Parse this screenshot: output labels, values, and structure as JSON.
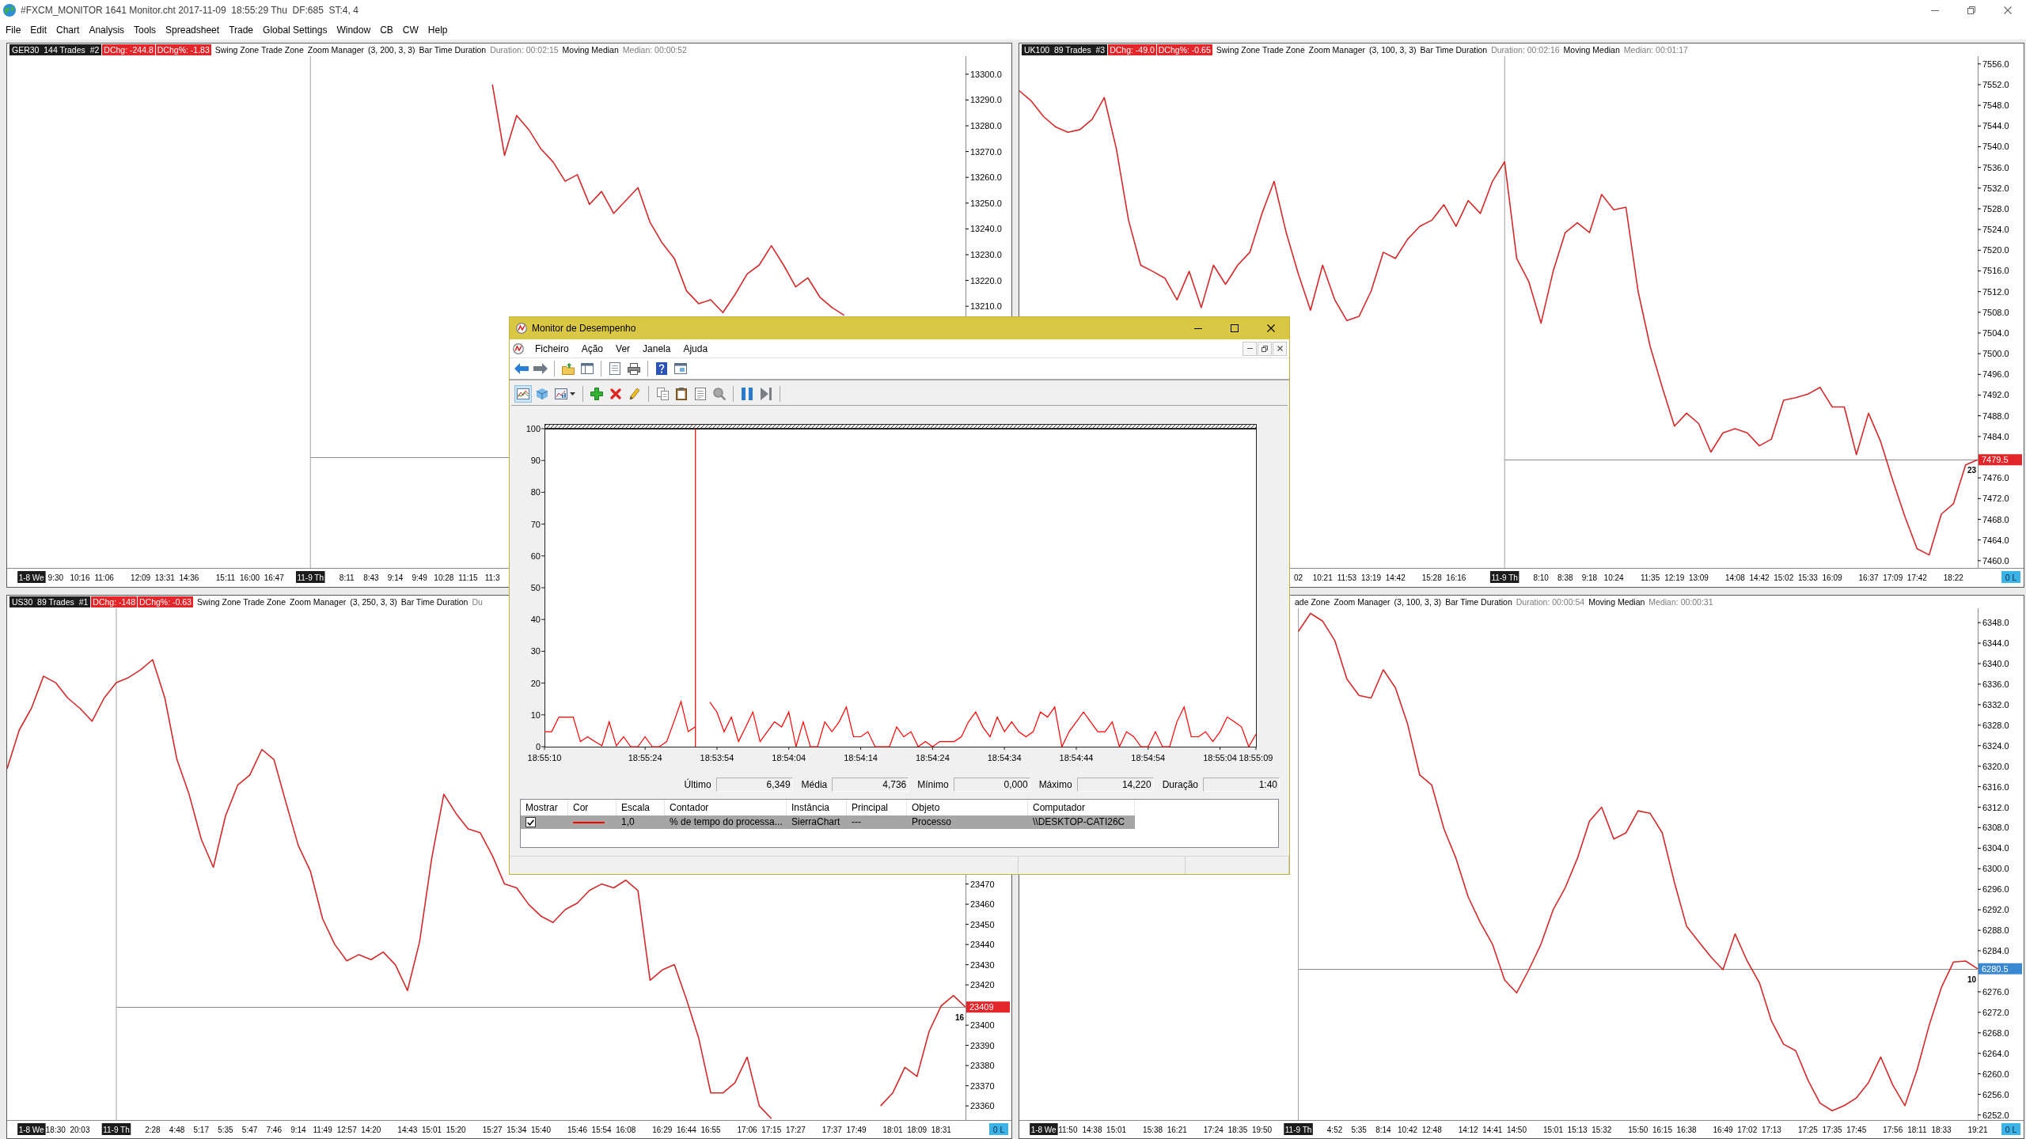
{
  "window": {
    "title": "#FXCM_MONITOR 1641 Monitor.cht 2017-11-09  18:55:29 Thu  DF:685  ST:4, 4",
    "menu": [
      "File",
      "Edit",
      "Chart",
      "Analysis",
      "Tools",
      "Spreadsheet",
      "Trade",
      "Global Settings",
      "Window",
      "CB",
      "CW",
      "Help"
    ]
  },
  "charts": [
    {
      "header": [
        {
          "kind": "symbol",
          "text": "GER30  144 Trades  #2"
        },
        {
          "kind": "change",
          "text": "DChg: -244.8"
        },
        {
          "kind": "change",
          "text": "DChg%: -1.83"
        },
        {
          "kind": "study",
          "text": "Swing Zone Trade Zone"
        },
        {
          "kind": "study",
          "text": "Zoom Manager"
        },
        {
          "kind": "study",
          "text": "(3, 200, 3, 3)"
        },
        {
          "kind": "study",
          "text": "Bar Time Duration"
        },
        {
          "kind": "value",
          "text": "Duration: 00:02:15"
        },
        {
          "kind": "study",
          "text": "Moving Median"
        },
        {
          "kind": "value",
          "text": "Median: 00:00:52"
        }
      ],
      "first_label_highlighted": true,
      "chart_data": {
        "type": "line",
        "categories": [
          null,
          null,
          "1-8 We",
          null,
          "9:30",
          null,
          "10:16",
          null,
          "11:06",
          null,
          null,
          "12:09",
          null,
          "13:31",
          null,
          "14:36",
          null,
          null,
          "15:11",
          null,
          "16:00",
          null,
          "16:47",
          null,
          null,
          "11-9 Th",
          null,
          null,
          "8:11",
          null,
          "8:43",
          null,
          "9:14",
          null,
          "9:49",
          null,
          "10:28",
          null,
          "11:15",
          null,
          "11:3",
          null,
          null,
          null,
          null,
          null,
          null,
          null,
          null,
          null,
          null,
          null,
          null,
          null,
          null,
          null,
          null,
          null,
          null,
          null,
          null,
          null,
          null,
          null,
          null,
          null,
          null,
          null,
          null,
          null,
          null,
          null,
          null,
          null,
          null,
          null,
          null,
          null,
          null,
          null
        ],
        "ylim": [
          13108.5,
          13307
        ],
        "yticks": [
          {
            "value": 13300,
            "label": "13300.0"
          },
          {
            "value": 13290,
            "label": "13290.0"
          },
          {
            "value": 13280,
            "label": "13280.0"
          },
          {
            "value": 13270,
            "label": "13270.0"
          },
          {
            "value": 13260,
            "label": "13260.0"
          },
          {
            "value": 13250,
            "label": "13250.0"
          },
          {
            "value": 13240,
            "label": "13240.0"
          },
          {
            "value": 13230,
            "label": "13230.0"
          },
          {
            "value": 13220,
            "label": "13220.0"
          },
          {
            "value": 13210,
            "label": "13210.0"
          }
        ],
        "series": [
          {
            "color": "#d42a2a",
            "values": [
              null,
              null,
              null,
              null,
              null,
              null,
              null,
              null,
              null,
              null,
              null,
              null,
              null,
              null,
              null,
              null,
              null,
              null,
              null,
              null,
              null,
              null,
              null,
              null,
              null,
              null,
              null,
              null,
              null,
              null,
              null,
              null,
              null,
              null,
              null,
              null,
              null,
              null,
              null,
              null,
              13296,
              13268.5,
              13284,
              13278.5,
              13271,
              13266,
              13258.5,
              13261,
              13249.5,
              13254.5,
              13246,
              13251,
              13256,
              13242.5,
              13234.5,
              13228.5,
              13216,
              13211,
              13212.5,
              13207.5,
              13214.5,
              13222.5,
              13226,
              13233.5,
              13226,
              13217.5,
              13221,
              13213.5,
              13209.5,
              13206.5,
              null,
              null,
              null,
              null,
              null,
              null,
              null,
              null,
              null,
              null
            ]
          }
        ],
        "ref_lines": [
          {
            "axis": "x",
            "value": "11-9 Th"
          },
          {
            "axis": "y",
            "value": 13151.5
          }
        ]
      }
    },
    {
      "header": [
        {
          "kind": "symbol",
          "text": "UK100  89 Trades  #3"
        },
        {
          "kind": "change",
          "text": "DChg: -49.0"
        },
        {
          "kind": "change",
          "text": "DChg%: -0.65"
        },
        {
          "kind": "study",
          "text": "Swing Zone Trade Zone"
        },
        {
          "kind": "study",
          "text": "Zoom Manager"
        },
        {
          "kind": "study",
          "text": "(3, 100, 3, 3)"
        },
        {
          "kind": "study",
          "text": "Bar Time Duration"
        },
        {
          "kind": "value",
          "text": "Duration: 00:02:16"
        },
        {
          "kind": "study",
          "text": "Moving Median"
        },
        {
          "kind": "value",
          "text": "Median: 00:01:17"
        }
      ],
      "chart_data": {
        "type": "line",
        "categories": [
          null,
          null,
          null,
          null,
          null,
          null,
          null,
          null,
          null,
          null,
          null,
          null,
          null,
          null,
          null,
          null,
          null,
          null,
          null,
          null,
          null,
          null,
          null,
          "02",
          null,
          "10:21",
          null,
          "11:53",
          null,
          "13:19",
          null,
          "14:42",
          null,
          null,
          "15:28",
          null,
          "16:16",
          null,
          null,
          null,
          "11-9 Th",
          null,
          null,
          "8:10",
          null,
          "8:38",
          null,
          "9:18",
          null,
          "10:24",
          null,
          null,
          "11:35",
          null,
          "12:19",
          null,
          "13:09",
          null,
          null,
          "14:08",
          null,
          "14:42",
          null,
          "15:02",
          null,
          "15:33",
          null,
          "16:09",
          null,
          null,
          "16:37",
          null,
          "17:09",
          null,
          "17:42",
          null,
          null,
          "18:22",
          null,
          null
        ],
        "ylim": [
          7458.6,
          7557.5
        ],
        "yticks": [
          {
            "value": 7556,
            "label": "7556.0"
          },
          {
            "value": 7552,
            "label": "7552.0"
          },
          {
            "value": 7548,
            "label": "7548.0"
          },
          {
            "value": 7544,
            "label": "7544.0"
          },
          {
            "value": 7540,
            "label": "7540.0"
          },
          {
            "value": 7536,
            "label": "7536.0"
          },
          {
            "value": 7532,
            "label": "7532.0"
          },
          {
            "value": 7528,
            "label": "7528.0"
          },
          {
            "value": 7524,
            "label": "7524.0"
          },
          {
            "value": 7520,
            "label": "7520.0"
          },
          {
            "value": 7516,
            "label": "7516.0"
          },
          {
            "value": 7512,
            "label": "7512.0"
          },
          {
            "value": 7508,
            "label": "7508.0"
          },
          {
            "value": 7504,
            "label": "7504.0"
          },
          {
            "value": 7500,
            "label": "7500.0"
          },
          {
            "value": 7496,
            "label": "7496.0"
          },
          {
            "value": 7492,
            "label": "7492.0"
          },
          {
            "value": 7488,
            "label": "7488.0"
          },
          {
            "value": 7484,
            "label": "7484.0"
          },
          {
            "value": 7476,
            "label": "7476.0"
          },
          {
            "value": 7472,
            "label": "7472.0"
          },
          {
            "value": 7468,
            "label": "7468.0"
          },
          {
            "value": 7464,
            "label": "7464.0"
          },
          {
            "value": 7460,
            "label": "7460.0"
          }
        ],
        "series": [
          {
            "color": "#d42a2a",
            "values": [
              7550.8,
              7548.8,
              7545.8,
              7543.8,
              7542.8,
              7543.3,
              7545.3,
              7549.5,
              7539.6,
              7525.8,
              7517.1,
              7515.9,
              7514.6,
              7510.4,
              7515.9,
              7508.9,
              7517.1,
              7513.4,
              7517.1,
              7519.6,
              7527.1,
              7533.3,
              7523.4,
              7515.4,
              7508.4,
              7517.1,
              7510.4,
              7506.4,
              7507.2,
              7512.1,
              7519.6,
              7518.4,
              7522.1,
              7524.6,
              7525.8,
              7528.8,
              7524.6,
              7529.6,
              7527.1,
              7533.3,
              7537.1,
              7518.4,
              7513.9,
              7505.9,
              7515.9,
              7523.4,
              7525.3,
              7523.4,
              7530.8,
              7527.8,
              7528.3,
              7512.1,
              7501.4,
              7493.5,
              7486.0,
              7488.5,
              7486.5,
              7481.0,
              7484.7,
              7485.5,
              7484.7,
              7482.2,
              7483.5,
              7491.0,
              7491.5,
              7492.2,
              7493.5,
              7489.7,
              7489.7,
              7480.5,
              7488.5,
              7483.0,
              7475.5,
              7468.5,
              7462.3,
              7461.1,
              7469.0,
              7471.0,
              7478.5,
              7479.5
            ]
          }
        ],
        "ref_lines": [
          {
            "axis": "x",
            "value": "11-9 Th"
          },
          {
            "axis": "y",
            "value": 7479.5,
            "label": "7479.5"
          }
        ]
      },
      "price_tag": {
        "color": "#e4262a"
      },
      "bar_count": "23",
      "corner_label": "0 L"
    },
    {
      "header": [
        {
          "kind": "symbol",
          "text": "US30  89 Trades  #1"
        },
        {
          "kind": "change",
          "text": "DChg: -148"
        },
        {
          "kind": "change",
          "text": "DChg%: -0.63"
        },
        {
          "kind": "study",
          "text": "Swing Zone Trade Zone"
        },
        {
          "kind": "study",
          "text": "Zoom Manager"
        },
        {
          "kind": "study",
          "text": "(3, 250, 3, 3)"
        },
        {
          "kind": "study",
          "text": "Bar Time Duration"
        },
        {
          "kind": "value",
          "text": "Du"
        }
      ],
      "first_label_highlighted": true,
      "chart_data": {
        "type": "line",
        "categories": [
          null,
          null,
          "1-8 We",
          null,
          "18:30",
          null,
          "20:03",
          null,
          null,
          "11-9 Th",
          null,
          null,
          "2:28",
          null,
          "4:48",
          null,
          "5:17",
          null,
          "5:35",
          null,
          "5:47",
          null,
          "7:46",
          null,
          "9:14",
          null,
          "11:49",
          null,
          "12:57",
          null,
          "14:20",
          null,
          null,
          "14:43",
          null,
          "15:01",
          null,
          "15:20",
          null,
          null,
          "15:27",
          null,
          "15:34",
          null,
          "15:40",
          null,
          null,
          "15:46",
          null,
          "15:54",
          null,
          "16:08",
          null,
          null,
          "16:29",
          null,
          "16:44",
          null,
          "16:55",
          null,
          null,
          "17:06",
          null,
          "17:15",
          null,
          "17:27",
          null,
          null,
          "17:37",
          null,
          "17:49",
          null,
          null,
          "18:01",
          null,
          "18:09",
          null,
          "18:31",
          null,
          null
        ],
        "ylim": [
          23353.0,
          23606.7
        ],
        "yticks": [
          {
            "value": 23470,
            "label": "23470"
          },
          {
            "value": 23460,
            "label": "23460"
          },
          {
            "value": 23450,
            "label": "23450"
          },
          {
            "value": 23440,
            "label": "23440"
          },
          {
            "value": 23430,
            "label": "23430"
          },
          {
            "value": 23420,
            "label": "23420"
          },
          {
            "value": 23400,
            "label": "23400"
          },
          {
            "value": 23390,
            "label": "23390"
          },
          {
            "value": 23380,
            "label": "23380"
          },
          {
            "value": 23370,
            "label": "23370"
          },
          {
            "value": 23360,
            "label": "23360"
          }
        ],
        "series": [
          {
            "color": "#d42a2a",
            "values": [
              23527.2,
              23546.3,
              23557.1,
              23573.0,
              23569.8,
              23562.2,
              23557.1,
              23550.7,
              23562.2,
              23569.8,
              23572.3,
              23576.2,
              23581.2,
              23562.2,
              23531.7,
              23514.5,
              23492.2,
              23478.3,
              23503.7,
              23519.0,
              23524.0,
              23536.7,
              23531.7,
              23510.0,
              23489.1,
              23476.4,
              23452.8,
              23440.1,
              23431.9,
              23435.0,
              23432.5,
              23436.3,
              23430.0,
              23417.2,
              23441.4,
              23482.7,
              23514.5,
              23505.0,
              23497.3,
              23495.4,
              23484.0,
              23470.0,
              23468.1,
              23459.8,
              23454.1,
              23450.9,
              23457.3,
              23460.5,
              23466.8,
              23470.0,
              23468.1,
              23471.9,
              23466.8,
              23422.3,
              23427.4,
              23430.0,
              23412.8,
              23393.7,
              23366.4,
              23366.4,
              23371.5,
              23384.2,
              23360.0,
              23353.7,
              null,
              null,
              null,
              null,
              null,
              null,
              null,
              null,
              23360.0,
              23366.4,
              23379.1,
              23374.6,
              23396.9,
              23409.6,
              23414.7,
              23409.0
            ]
          }
        ],
        "ref_lines": [
          {
            "axis": "x",
            "value": "11-9 Th"
          },
          {
            "axis": "y",
            "value": 23409,
            "label": "23409"
          }
        ]
      },
      "price_tag": {
        "color": "#e4262a"
      },
      "bar_count": "16",
      "corner_label": "0 L"
    },
    {
      "header": [
        {
          "kind": "study",
          "text": "ade Zone"
        },
        {
          "kind": "study",
          "text": "Zoom Manager"
        },
        {
          "kind": "study",
          "text": "(3, 100, 3, 3)"
        },
        {
          "kind": "study",
          "text": "Bar Time Duration"
        },
        {
          "kind": "value",
          "text": "Duration: 00:00:54"
        },
        {
          "kind": "study",
          "text": "Moving Median"
        },
        {
          "kind": "value",
          "text": "Median: 00:00:31"
        }
      ],
      "first_label_highlighted": true,
      "chart_data": {
        "type": "line",
        "categories": [
          null,
          null,
          "1-8 We",
          null,
          "11:50",
          null,
          "14:38",
          null,
          "15:01",
          null,
          null,
          "15:38",
          null,
          "16:21",
          null,
          null,
          "17:24",
          null,
          "18:35",
          null,
          "19:50",
          null,
          null,
          "11-9 Th",
          null,
          null,
          "4:52",
          null,
          "5:35",
          null,
          "8:14",
          null,
          "10:42",
          null,
          "12:48",
          null,
          null,
          "14:12",
          null,
          "14:41",
          null,
          "14:50",
          null,
          null,
          "15:01",
          null,
          "15:13",
          null,
          "15:32",
          null,
          null,
          "15:50",
          null,
          "16:15",
          null,
          "16:38",
          null,
          null,
          "16:49",
          null,
          "17:02",
          null,
          "17:13",
          null,
          null,
          "17:25",
          null,
          "17:35",
          null,
          "17:45",
          null,
          null,
          "17:56",
          null,
          "18:11",
          null,
          "18:33",
          null,
          null,
          "19:21"
        ],
        "ylim": [
          6251.0,
          6350.8
        ],
        "yticks": [
          {
            "value": 6348,
            "label": "6348.0"
          },
          {
            "value": 6344,
            "label": "6344.0"
          },
          {
            "value": 6340,
            "label": "6340.0"
          },
          {
            "value": 6336,
            "label": "6336.0"
          },
          {
            "value": 6332,
            "label": "6332.0"
          },
          {
            "value": 6328,
            "label": "6328.0"
          },
          {
            "value": 6324,
            "label": "6324.0"
          },
          {
            "value": 6320,
            "label": "6320.0"
          },
          {
            "value": 6316,
            "label": "6316.0"
          },
          {
            "value": 6312,
            "label": "6312.0"
          },
          {
            "value": 6308,
            "label": "6308.0"
          },
          {
            "value": 6304,
            "label": "6304.0"
          },
          {
            "value": 6300,
            "label": "6300.0"
          },
          {
            "value": 6296,
            "label": "6296.0"
          },
          {
            "value": 6292,
            "label": "6292.0"
          },
          {
            "value": 6288,
            "label": "6288.0"
          },
          {
            "value": 6284,
            "label": "6284.0"
          },
          {
            "value": 6276,
            "label": "6276.0"
          },
          {
            "value": 6272,
            "label": "6272.0"
          },
          {
            "value": 6268,
            "label": "6268.0"
          },
          {
            "value": 6264,
            "label": "6264.0"
          },
          {
            "value": 6260,
            "label": "6260.0"
          },
          {
            "value": 6256,
            "label": "6256.0"
          },
          {
            "value": 6252,
            "label": "6252.0"
          }
        ],
        "series": [
          {
            "color": "#d42a2a",
            "values": [
              null,
              null,
              null,
              null,
              null,
              null,
              null,
              null,
              null,
              null,
              null,
              null,
              null,
              null,
              null,
              null,
              null,
              null,
              null,
              null,
              null,
              null,
              null,
              6346.3,
              6349.8,
              6348.3,
              6344.5,
              6337.0,
              6333.8,
              6333.3,
              6338.8,
              6335.3,
              6328.3,
              6318.3,
              6316.3,
              6307.8,
              6302.0,
              6294.5,
              6289.5,
              6285.3,
              6278.3,
              6275.8,
              6280.3,
              6285.3,
              6292.0,
              6296.3,
              6302.0,
              6309.3,
              6312.0,
              6305.8,
              6307.0,
              6311.3,
              6310.8,
              6307.0,
              6297.3,
              6288.8,
              6285.8,
              6282.8,
              6280.3,
              6287.3,
              6282.0,
              6277.8,
              6270.3,
              6265.8,
              6264.5,
              6258.8,
              6254.3,
              6252.8,
              6253.8,
              6255.3,
              6258.3,
              6263.3,
              6257.8,
              6253.8,
              6260.8,
              6269.5,
              6276.8,
              6281.8,
              6282.0,
              6280.5
            ]
          }
        ],
        "ref_lines": [
          {
            "axis": "x",
            "value": "11-9 Th"
          },
          {
            "axis": "y",
            "value": 6280.5,
            "label": "6280.5"
          }
        ]
      },
      "price_tag": {
        "color": "#3b88d2"
      },
      "bar_count": "10",
      "corner_label": "0 L"
    }
  ],
  "monitor": {
    "title": "Monitor de Desempenho",
    "menu": [
      "Ficheiro",
      "Ação",
      "Ver",
      "Janela",
      "Ajuda"
    ],
    "view_modes": [
      {
        "kind": "button",
        "selected": true
      },
      {
        "kind": "button",
        "selected": false
      },
      {
        "kind": "dropdown",
        "selected": false
      }
    ],
    "chart_data": {
      "type": "line",
      "categories": [
        "18:55:10",
        null,
        null,
        null,
        null,
        null,
        null,
        null,
        null,
        null,
        null,
        null,
        null,
        null,
        "18:55:24",
        null,
        null,
        null,
        null,
        null,
        null,
        null,
        null,
        null,
        "18:53:54",
        null,
        null,
        null,
        null,
        null,
        null,
        null,
        null,
        null,
        "18:54:04",
        null,
        null,
        null,
        null,
        null,
        null,
        null,
        null,
        null,
        "18:54:14",
        null,
        null,
        null,
        null,
        null,
        null,
        null,
        null,
        null,
        "18:54:24",
        null,
        null,
        null,
        null,
        null,
        null,
        null,
        null,
        null,
        "18:54:34",
        null,
        null,
        null,
        null,
        null,
        null,
        null,
        null,
        null,
        "18:54:44",
        null,
        null,
        null,
        null,
        null,
        null,
        null,
        null,
        null,
        "18:54:54",
        null,
        null,
        null,
        null,
        null,
        null,
        null,
        null,
        null,
        "18:55:04",
        null,
        null,
        null,
        null,
        "18:55:09"
      ],
      "ylim": [
        0,
        100
      ],
      "yticks": [
        0,
        10,
        20,
        30,
        40,
        50,
        60,
        70,
        80,
        90,
        100
      ],
      "series": [
        {
          "color": "#ff0000",
          "values": [
            4.7,
            4.7,
            9.3,
            9.3,
            9.3,
            1.6,
            3.1,
            1.6,
            0.3,
            7.8,
            0.3,
            3.1,
            0,
            0,
            3.1,
            0,
            0,
            1.6,
            7.8,
            14.2,
            4.7,
            6.3,
            null,
            14.0,
            10.9,
            4.7,
            9.3,
            1.6,
            6.2,
            10.9,
            1.6,
            4.7,
            7.8,
            6.2,
            10.9,
            0,
            7.8,
            0,
            0,
            7.8,
            4.7,
            7.8,
            12.5,
            3.1,
            3.1,
            4.7,
            0,
            0,
            0,
            6.2,
            3.1,
            4.7,
            0,
            1.6,
            0,
            1.6,
            1.6,
            1.6,
            3.1,
            7.8,
            10.9,
            6.2,
            3.1,
            9.3,
            4.7,
            7.8,
            4.7,
            3.1,
            4.7,
            10.9,
            9.3,
            12.5,
            0,
            4.7,
            7.8,
            10.9,
            7.8,
            4.7,
            4.7,
            7.8,
            0,
            4.7,
            3.1,
            0,
            0,
            4.7,
            0,
            0,
            7.8,
            12.5,
            3.1,
            3.1,
            4.7,
            1.6,
            4.7,
            9.3,
            7.8,
            6.2,
            0,
            3.9
          ]
        }
      ]
    },
    "stats": [
      {
        "label": "Último",
        "value": "6,349"
      },
      {
        "label": "Média",
        "value": "4,736"
      },
      {
        "label": "Mínimo",
        "value": "0,000"
      },
      {
        "label": "Máximo",
        "value": "14,220"
      },
      {
        "label": "Duração",
        "value": "1:40"
      }
    ],
    "counters": {
      "columns": [
        "Mostrar",
        "Cor",
        "Escala",
        "Contador",
        "Instância",
        "Principal",
        "Objeto",
        "Computador"
      ],
      "rows": [
        {
          "selected": true,
          "checked": true,
          "color": "#ff0000",
          "cells": [
            "",
            "",
            "1,0",
            "% de tempo do processa...",
            "SierraChart",
            "---",
            "Processo",
            "\\\\DESKTOP-CATI26C"
          ]
        }
      ]
    }
  }
}
